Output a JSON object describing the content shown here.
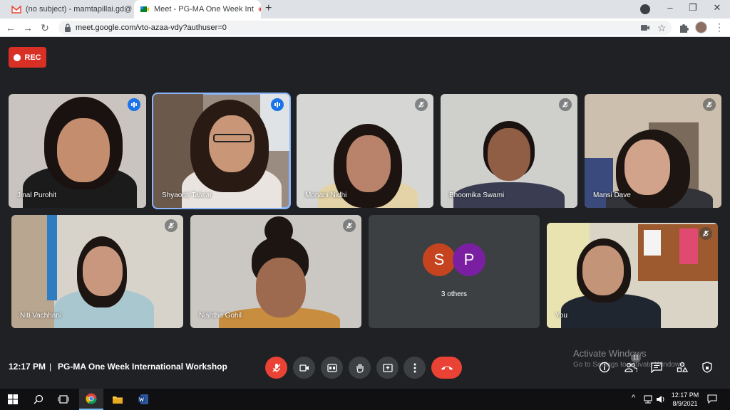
{
  "browser": {
    "tabs": [
      {
        "label": "(no subject) - mamtapillai.gd@in",
        "icon": "gmail-icon",
        "active": false
      },
      {
        "label": "Meet - PG-MA One Week Int",
        "icon": "meet-icon",
        "active": true
      }
    ],
    "new_tab_label": "+",
    "url": "meet.google.com/vto-azaa-vdy?authuser=0"
  },
  "meet": {
    "rec_label": "REC",
    "participants": [
      {
        "name": "Jinal Purohit",
        "status": "speaking"
      },
      {
        "name": "Shyaonti Talwar",
        "status": "speaking"
      },
      {
        "name": "Monani Nidhi",
        "status": "muted"
      },
      {
        "name": "Bhoomika Swami",
        "status": "muted"
      },
      {
        "name": "Mansi Dave",
        "status": "muted"
      },
      {
        "name": "Niti Vachhani",
        "status": "muted"
      },
      {
        "name": "Nishtha Gohil",
        "status": "muted"
      },
      {
        "name": "You",
        "status": "muted"
      }
    ],
    "others": {
      "avatars": [
        {
          "letter": "S",
          "color": "#c5441f"
        },
        {
          "letter": "P",
          "color": "#7b1fa2"
        }
      ],
      "label": "3 others"
    },
    "time": "12:17 PM",
    "separator": "|",
    "meeting_title": "PG-MA One Week International Workshop",
    "participant_count": "11",
    "accent": "#8ab4f8",
    "danger": "#ea4335"
  },
  "watermark": {
    "line1": "Activate Windows",
    "line2": "Go to Settings to activate Windows."
  },
  "taskbar": {
    "time": "12:17 PM",
    "date": "8/9/2021"
  }
}
